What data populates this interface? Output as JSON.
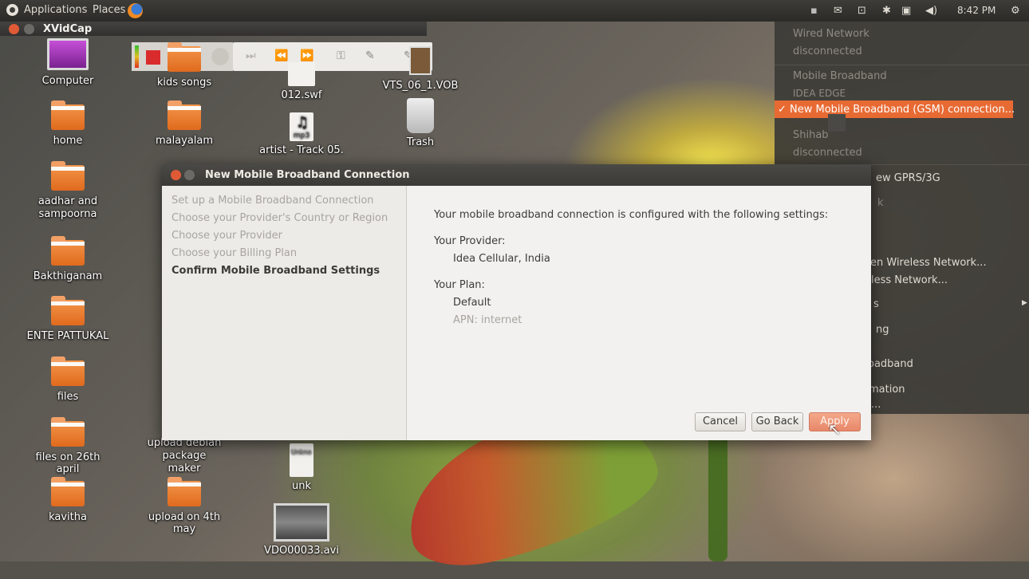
{
  "top_panel": {
    "menus": [
      "Applications",
      "Places"
    ],
    "clock": "8:42 PM"
  },
  "xvidcap": {
    "title": "XVidCap"
  },
  "desktop_icons": [
    {
      "label": "Computer",
      "kind": "computer"
    },
    {
      "label": "kids songs",
      "kind": "folder"
    },
    {
      "label": "012.swf",
      "kind": "file"
    },
    {
      "label": "VTS_06_1.VOB",
      "kind": "video"
    },
    {
      "label": "home",
      "kind": "home-folder"
    },
    {
      "label": "malayalam",
      "kind": "folder"
    },
    {
      "label": "artist - Track 05.",
      "kind": "mp3",
      "badge": "mp3"
    },
    {
      "label": "Trash",
      "kind": "trash"
    },
    {
      "label": "aadhar and sampoorna",
      "kind": "folder"
    },
    {
      "label": "Bakthiganam",
      "kind": "folder"
    },
    {
      "label": "ENTE PATTUKAL",
      "kind": "folder"
    },
    {
      "label": "files",
      "kind": "folder"
    },
    {
      "label": "files on 26th april",
      "kind": "folder"
    },
    {
      "label": "upload debian package maker",
      "kind": "folder"
    },
    {
      "label": "unk",
      "kind": "file",
      "badge": "Unkno"
    },
    {
      "label": "kavitha",
      "kind": "folder"
    },
    {
      "label": "upload on 4th may",
      "kind": "folder"
    },
    {
      "label": "VDO00033.avi",
      "kind": "video"
    }
  ],
  "dialog": {
    "title": "New Mobile Broadband Connection",
    "steps": [
      {
        "label": "Set up a Mobile Broadband Connection",
        "active": false
      },
      {
        "label": "Choose your Provider's Country or Region",
        "active": false
      },
      {
        "label": "Choose your Provider",
        "active": false
      },
      {
        "label": "Choose your Billing Plan",
        "active": false
      },
      {
        "label": "Confirm Mobile Broadband Settings",
        "active": true
      }
    ],
    "intro": "Your mobile broadband connection is configured with the following settings:",
    "provider_heading": "Your Provider:",
    "provider_value": "Idea Cellular, India",
    "plan_heading": "Your Plan:",
    "plan_value": "Default",
    "apn": "APN: internet",
    "buttons": {
      "cancel": "Cancel",
      "back": "Go Back",
      "apply": "Apply"
    }
  },
  "network_menu": {
    "items": [
      {
        "label": "Wired Network",
        "dim": true
      },
      {
        "label": "disconnected",
        "dim": true
      },
      {
        "label": "Mobile Broadband",
        "dim": true
      },
      {
        "label": "IDEA EDGE",
        "dim": true
      },
      {
        "label": "✓ New Mobile Broadband (GSM) connection...",
        "selected": true
      },
      {
        "label": "Shihab",
        "dim": true
      },
      {
        "label": "disconnected",
        "dim": true
      },
      {
        "label": "ew GPRS/3G"
      },
      {
        "label": "k",
        "dim": true
      },
      {
        "label": "en Wireless Network..."
      },
      {
        "label": "less Network..."
      },
      {
        "label": "s"
      },
      {
        "label": "ng"
      },
      {
        "label": "oadband"
      },
      {
        "label": "mation"
      },
      {
        "label": "..."
      }
    ]
  },
  "colors": {
    "accent": "#e86a33",
    "panel": "#3c3b37",
    "folder": "#e8742a"
  }
}
